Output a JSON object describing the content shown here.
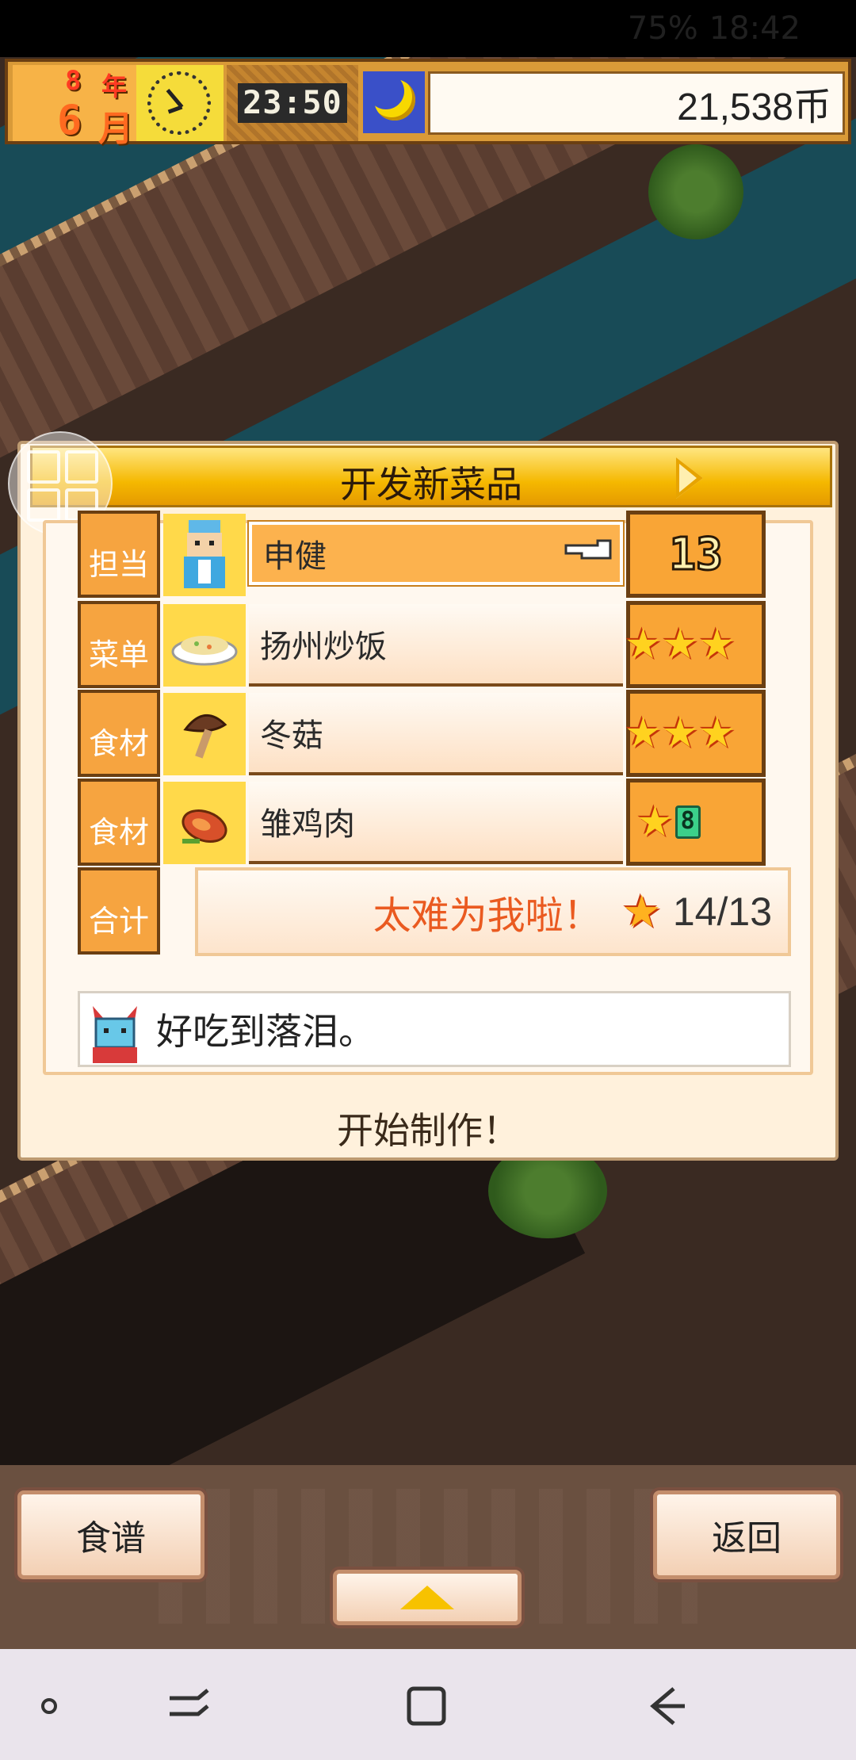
{
  "status_bar": {
    "text": "75%",
    "time": "18:42"
  },
  "hud": {
    "year": "8",
    "year_label": "年",
    "month": "6",
    "month_label": "月",
    "time": "23:50",
    "coins": "21,538币"
  },
  "dialog": {
    "title": "开发新菜品",
    "rows": [
      {
        "label": "担当",
        "name": "申健",
        "level": "13",
        "icon": "chef-icon"
      },
      {
        "label": "菜单",
        "name": "扬州炒饭",
        "stars": 3,
        "icon": "fried-rice-icon"
      },
      {
        "label": "食材",
        "name": "冬菇",
        "stars": 3,
        "icon": "mushroom-icon"
      },
      {
        "label": "食材",
        "name": "雏鸡肉",
        "stars": 1,
        "gem": "8",
        "icon": "chicken-icon"
      }
    ],
    "total": {
      "label": "合计",
      "comment": "太难为我啦！",
      "score": "14/13"
    },
    "review": "好吃到落泪。",
    "start_label": "开始制作！"
  },
  "bottom": {
    "recipe_label": "食谱",
    "back_label": "返回"
  },
  "colors": {
    "hud": "#d99a38",
    "label_orange": "#f6a440",
    "accent_red": "#ea5a20"
  }
}
